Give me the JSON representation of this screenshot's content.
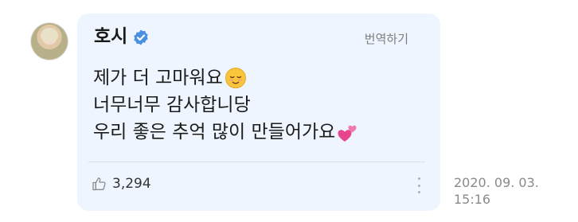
{
  "post": {
    "username": "호시",
    "verified": true,
    "translate_label": "번역하기",
    "message_lines": [
      "제가 더 고마워요",
      "너무너무 감사합니당",
      "우리 좋은 추억 많이 만들어가요"
    ],
    "emojis": [
      "relieved-face-icon",
      "two-hearts-icon"
    ],
    "like_count": "3,294",
    "timestamp_date": "2020. 09. 03.",
    "timestamp_time": "15:16"
  },
  "colors": {
    "bubble_bg": "#eef5fe",
    "verified_blue": "#4a90e2",
    "text": "#1b1b1b",
    "muted": "#8a8a8a"
  }
}
